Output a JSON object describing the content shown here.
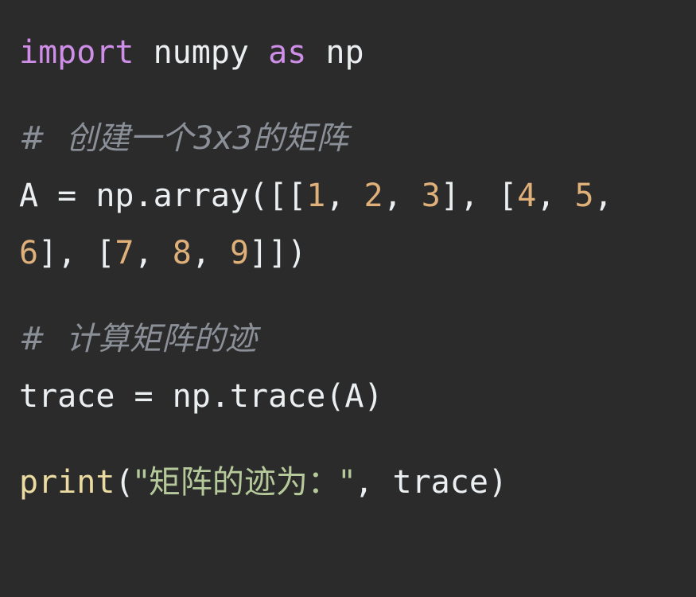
{
  "editor": {
    "language": "python",
    "background_color": "#2b2b2b",
    "theme": "dark",
    "top_strip_color": "#2f2f3c"
  },
  "syntax_colors": {
    "keyword": "#cf8ee8",
    "plain": "#eceff1",
    "number": "#dfb07a",
    "string": "#b5c99a",
    "function": "#ecdba0",
    "comment": "#8b9098"
  },
  "code": {
    "line_import": {
      "keyword_import": "import",
      "space_1": " ",
      "module": "numpy",
      "space_2": " ",
      "keyword_as": "as",
      "space_3": " ",
      "alias": "np"
    },
    "comment_matrix": "#  创建一个3x3的矩阵",
    "line_array_part1": {
      "variable": "A = np.array([[",
      "n1": "1",
      "sep1": ", ",
      "n2": "2",
      "sep2": ", ",
      "n3": "3",
      "sep3": "], [",
      "n4": "4",
      "sep4": ", ",
      "n5": "5",
      "sep5": ","
    },
    "line_array_part2": {
      "n6": "6",
      "sep6": "], [",
      "n7": "7",
      "sep7": ", ",
      "n8": "8",
      "sep8": ", ",
      "n9": "9",
      "sep9": "]])"
    },
    "comment_trace": "#  计算矩阵的迹",
    "line_trace": "trace = np.trace(A)",
    "line_print": {
      "function": "print",
      "open_paren": "(",
      "string": "\"矩阵的迹为：\"",
      "separator": ", ",
      "argument": "trace",
      "close_paren": ")"
    }
  }
}
